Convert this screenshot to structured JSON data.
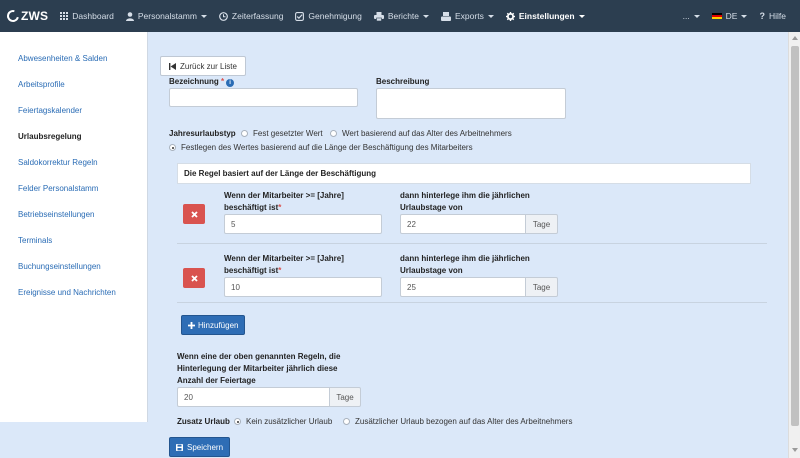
{
  "brand": {
    "name": "ZWS"
  },
  "nav": {
    "items": [
      {
        "label": "Dashboard",
        "icon": "grid-icon"
      },
      {
        "label": "Personalstamm",
        "icon": "user-icon"
      },
      {
        "label": "Zeiterfassung",
        "icon": "clock-icon"
      },
      {
        "label": "Genehmigung",
        "icon": "check-square-icon"
      },
      {
        "label": "Berichte",
        "icon": "print-icon"
      },
      {
        "label": "Exports",
        "icon": "export-icon"
      },
      {
        "label": "Einstellungen",
        "icon": "gear-icon"
      }
    ],
    "more": "...",
    "language": "DE",
    "help": "Hilfe"
  },
  "sidebar": {
    "items": [
      "Abwesenheiten & Salden",
      "Arbeitsprofile",
      "Feiertagskalender",
      "Urlaubsregelung",
      "Saldokorrektur Regeln",
      "Felder Personalstamm",
      "Betriebseinstellungen",
      "Terminals",
      "Buchungseinstellungen",
      "Ereignisse und Nachrichten"
    ],
    "active_index": 3
  },
  "form": {
    "back_label": "Zurück zur Liste",
    "bezeichnung_label": "Bezeichnung",
    "bezeichnung_value": "",
    "beschreibung_label": "Beschreibung",
    "beschreibung_value": "",
    "jahresurlaubstyp_label": "Jahresurlaubstyp",
    "type_options": [
      "Fest gesetzter Wert",
      "Wert basierend auf das Alter des Arbeitnehmers",
      "Festlegen des Wertes basierend auf die Länge der Beschäftigung des Mitarbeiters"
    ],
    "type_selected_index": 2,
    "rule_panel_title": "Die Regel basiert auf der Länge der Beschäftigung",
    "rule_label_years_line1": "Wenn der Mitarbeiter >= [Jahre]",
    "rule_label_years_line2": "beschäftigt ist",
    "rule_label_days_line1": "dann hinterlege ihm die jährlichen",
    "rule_label_days_line2": "Urlaubstage von",
    "unit_days": "Tage",
    "rules": [
      {
        "years": "5",
        "days": "22"
      },
      {
        "years": "10",
        "days": "25"
      }
    ],
    "add_label": "Hinzufügen",
    "fallback_label_line1": "Wenn eine der oben genannten Regeln, die",
    "fallback_label_line2": "Hinterlegung der Mitarbeiter jährlich diese",
    "fallback_label_line3": "Anzahl der Feiertage",
    "fallback_value": "20",
    "zusatz_label": "Zusatz Urlaub",
    "zusatz_options": [
      "Kein zusätzlicher Urlaub",
      "Zusätzlicher Urlaub bezogen auf das Alter des Arbeitnehmers"
    ],
    "zusatz_selected_index": 0,
    "save_label": "Speichern"
  },
  "colors": {
    "navbar": "#2c3e50",
    "background": "#dbe8f9",
    "primary": "#2e6db5",
    "danger": "#d9534f",
    "link": "#2a6cb5"
  }
}
